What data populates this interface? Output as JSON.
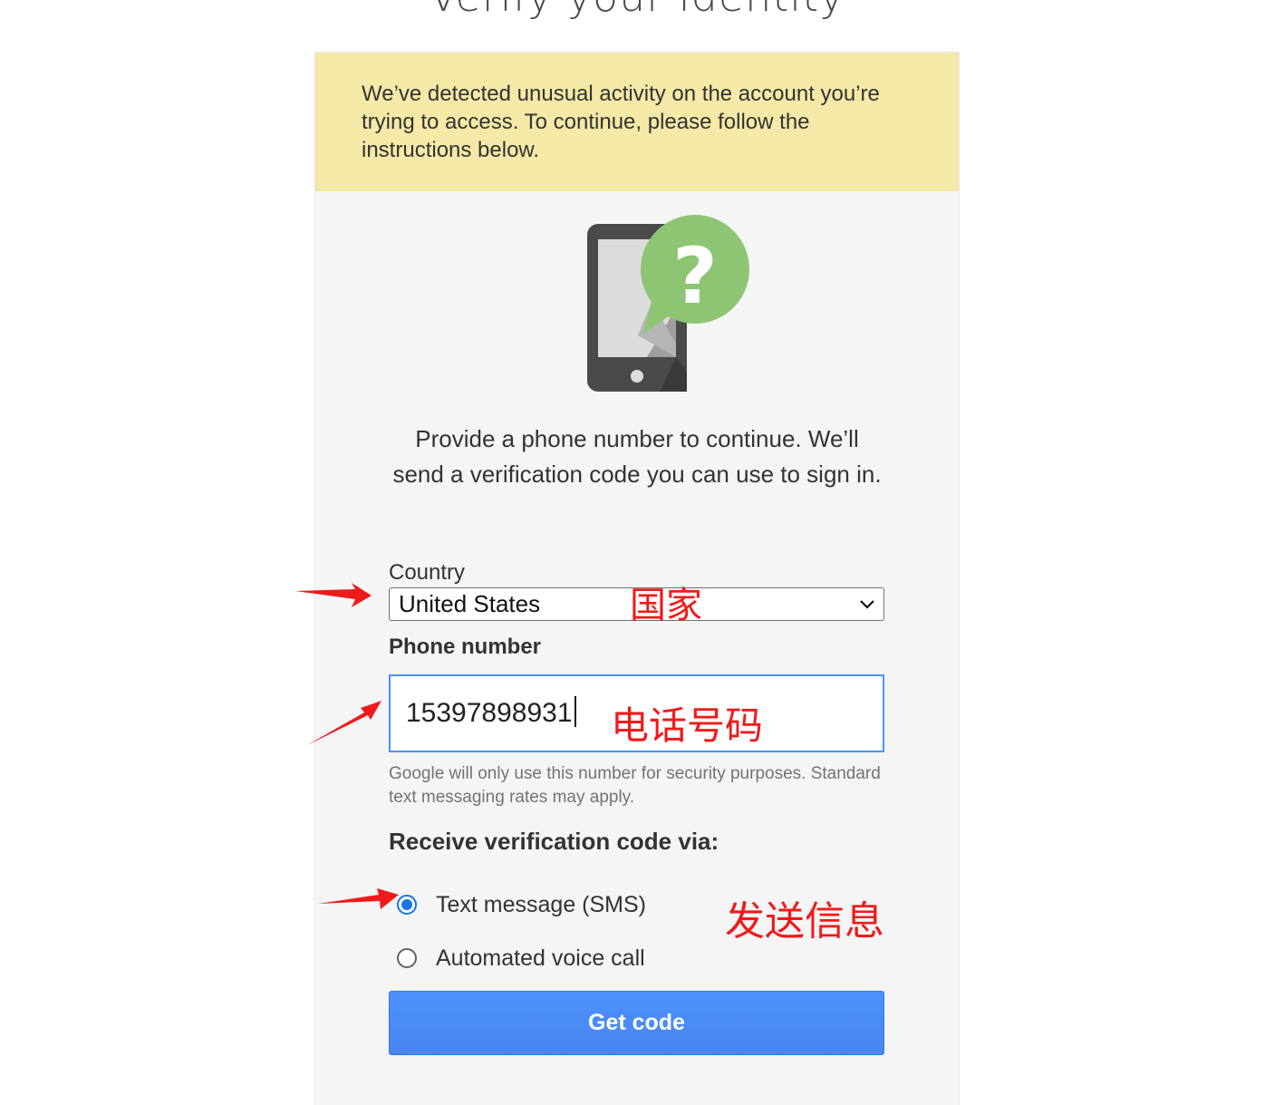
{
  "page": {
    "title": "Verify your identity"
  },
  "alert": {
    "message": "We’ve detected unusual activity on the account you’re trying to access. To continue, please follow the instructions below."
  },
  "illustration": {
    "icon": "phone-question-icon",
    "phone_color": "#4a4a4a",
    "bubble_color": "#8dc572"
  },
  "instructions": {
    "text": "Provide a phone number to continue. We’ll send a verification code you can use to sign in."
  },
  "form": {
    "country_label": "Country",
    "country_value": "United States",
    "phone_label": "Phone number",
    "phone_value": "15397898931",
    "help_text": "Google will only use this number for security purposes. Standard text messaging rates may apply.",
    "receive_label": "Receive verification code via:",
    "options": [
      {
        "label": "Text message (SMS)",
        "selected": true
      },
      {
        "label": "Automated voice call",
        "selected": false
      }
    ],
    "submit_label": "Get code"
  },
  "annotations": {
    "country": "国家",
    "phone": "电话号码",
    "sms": "发送信息",
    "color": "#f01a1a"
  },
  "colors": {
    "alert_bg": "#f4e9a6",
    "card_bg": "#f5f5f5",
    "button": "#4d90fe",
    "focus_border": "#4d90fe"
  }
}
